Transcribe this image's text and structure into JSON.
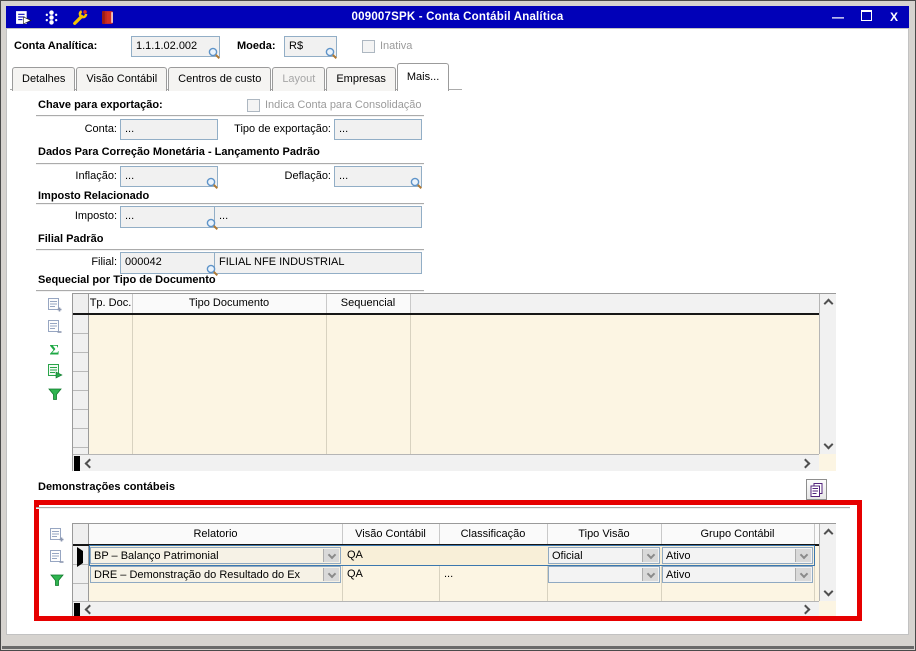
{
  "colors": {
    "titlebar": "#0101B8",
    "annotation_red": "#E60000",
    "grid_body_cream": "#FCF5E3",
    "selected_row_border": "#3B77AE",
    "field_border": "#92AEC6"
  },
  "window": {
    "title": "009007SPK - Conta Contábil Analítica",
    "minimize_glyph": "—",
    "close_glyph": "X",
    "titlebar_icons": [
      "form-export-icon",
      "traffic-light-icon",
      "wrench-icon",
      "book-icon"
    ]
  },
  "account_header": {
    "conta_analitica_label": "Conta Analítica:",
    "conta_analitica_value": "1.1.1.02.002",
    "moeda_label": "Moeda:",
    "moeda_value": "R$",
    "inativa_label": "Inativa"
  },
  "tabs": [
    {
      "label": "Detalhes",
      "state": "normal"
    },
    {
      "label": "Visão Contábil",
      "state": "normal"
    },
    {
      "label": "Centros de custo",
      "state": "normal"
    },
    {
      "label": "Layout",
      "state": "disabled"
    },
    {
      "label": "Empresas",
      "state": "normal"
    },
    {
      "label": "Mais...",
      "state": "active"
    }
  ],
  "export_section": {
    "heading": "Chave para exportação:",
    "consolidacao_label": "Indica Conta para Consolidação",
    "conta_label": "Conta:",
    "conta_value": "...",
    "tipo_label": "Tipo de exportação:",
    "tipo_value": "..."
  },
  "monetary_section": {
    "heading": "Dados Para Correção Monetária - Lançamento Padrão",
    "inflacao_label": "Inflação:",
    "inflacao_value": "...",
    "deflacao_label": "Deflação:",
    "deflacao_value": "..."
  },
  "tax_section": {
    "heading": "Imposto Relacionado",
    "imposto_label": "Imposto:",
    "imposto_code": "...",
    "imposto_desc": "..."
  },
  "branch_section": {
    "heading": "Filial Padrão",
    "filial_label": "Filial:",
    "filial_code": "000042",
    "filial_desc": "FILIAL NFE INDUSTRIAL"
  },
  "sequential_grid": {
    "heading": "Sequecial por Tipo de Documento",
    "columns": [
      "Tp. Doc.",
      "Tipo Documento",
      "Sequencial"
    ],
    "rows": [],
    "toolbar_icons": [
      "add-row-icon",
      "delete-row-icon",
      "sum-icon",
      "execute-icon",
      "filter-icon"
    ]
  },
  "statements_grid": {
    "heading": "Demonstrações contábeis",
    "columns": [
      "Relatorio",
      "Visão Contábil",
      "Classificação",
      "Tipo Visão",
      "Grupo Contábil"
    ],
    "rows": [
      {
        "relatorio": "BP – Balanço Patrimonial",
        "visao_contabil": "QA",
        "classificacao": "",
        "tipo_visao": "Oficial",
        "grupo_contabil": "Ativo",
        "selected": true
      },
      {
        "relatorio": "DRE – Demonstração do Resultado do Ex",
        "visao_contabil": "QA",
        "classificacao": "...",
        "tipo_visao": "",
        "grupo_contabil": "Ativo",
        "selected": false
      }
    ],
    "toolbar_icons": [
      "add-row-icon",
      "delete-row-icon",
      "filter-icon"
    ]
  }
}
